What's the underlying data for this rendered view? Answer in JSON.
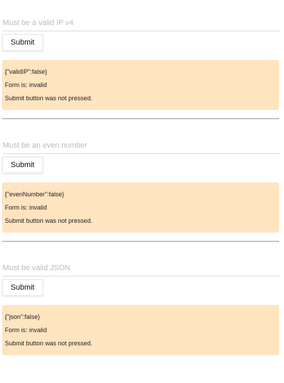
{
  "forms": [
    {
      "placeholder": "Must be a valid IP v4",
      "submit": "Submit",
      "json": "{\"validIP\":false}",
      "status": "Form is: invalid",
      "pressed": "Submit button was not pressed."
    },
    {
      "placeholder": "Must be an even number",
      "submit": "Submit",
      "json": "{\"evenNumber\":false}",
      "status": "Form is: invalid",
      "pressed": "Submit button was not pressed."
    },
    {
      "placeholder": "Must be valid JSON",
      "submit": "Submit",
      "json": "{\"json\":false}",
      "status": "Form is: invalid",
      "pressed": "Submit button was not pressed."
    }
  ]
}
